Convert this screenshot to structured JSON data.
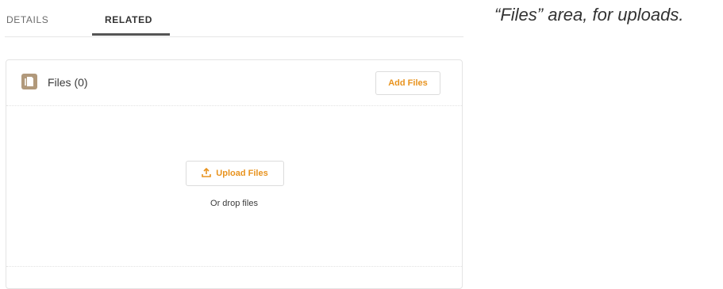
{
  "tabs": [
    {
      "label": "DETAILS",
      "active": false
    },
    {
      "label": "RELATED",
      "active": true
    }
  ],
  "files_card": {
    "title": "Files (0)",
    "add_button": "Add Files",
    "upload_button": "Upload Files",
    "drop_text": "Or drop files",
    "icon": "document-icon",
    "upload_icon": "upload-icon"
  },
  "caption": "“Files” area, for uploads.",
  "colors": {
    "accent": "#e8931e",
    "icon_bg": "#b1997b",
    "tab_underline": "#555555",
    "border": "#e4e4e4"
  }
}
